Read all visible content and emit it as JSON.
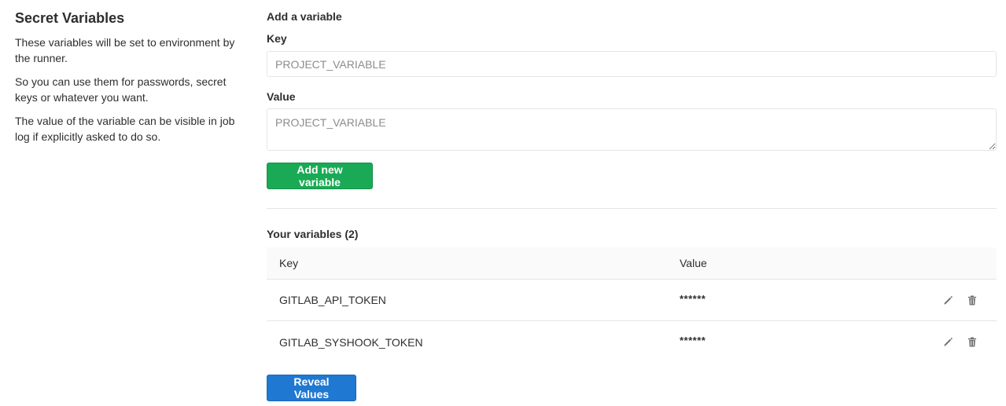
{
  "sidebar": {
    "title": "Secret Variables",
    "paragraphs": [
      "These variables will be set to environment by the runner.",
      "So you can use them for passwords, secret keys or whatever you want.",
      "The value of the variable can be visible in job log if explicitly asked to do so."
    ]
  },
  "form": {
    "title": "Add a variable",
    "key_label": "Key",
    "key_placeholder": "PROJECT_VARIABLE",
    "value_label": "Value",
    "value_placeholder": "PROJECT_VARIABLE",
    "submit_label": "Add new variable"
  },
  "variables": {
    "title": "Your variables (2)",
    "columns": [
      "Key",
      "Value"
    ],
    "rows": [
      {
        "key": "GITLAB_API_TOKEN",
        "value": "******",
        "edit_icon": "pencil-icon",
        "delete_icon": "trash-icon"
      },
      {
        "key": "GITLAB_SYSHOOK_TOKEN",
        "value": "******",
        "edit_icon": "pencil-icon",
        "delete_icon": "trash-icon"
      }
    ],
    "reveal_label": "Reveal Values"
  },
  "colors": {
    "success": "#1aaa55",
    "primary": "#1f78d1",
    "border": "#e5e5e5",
    "header_bg": "#fafafa"
  }
}
